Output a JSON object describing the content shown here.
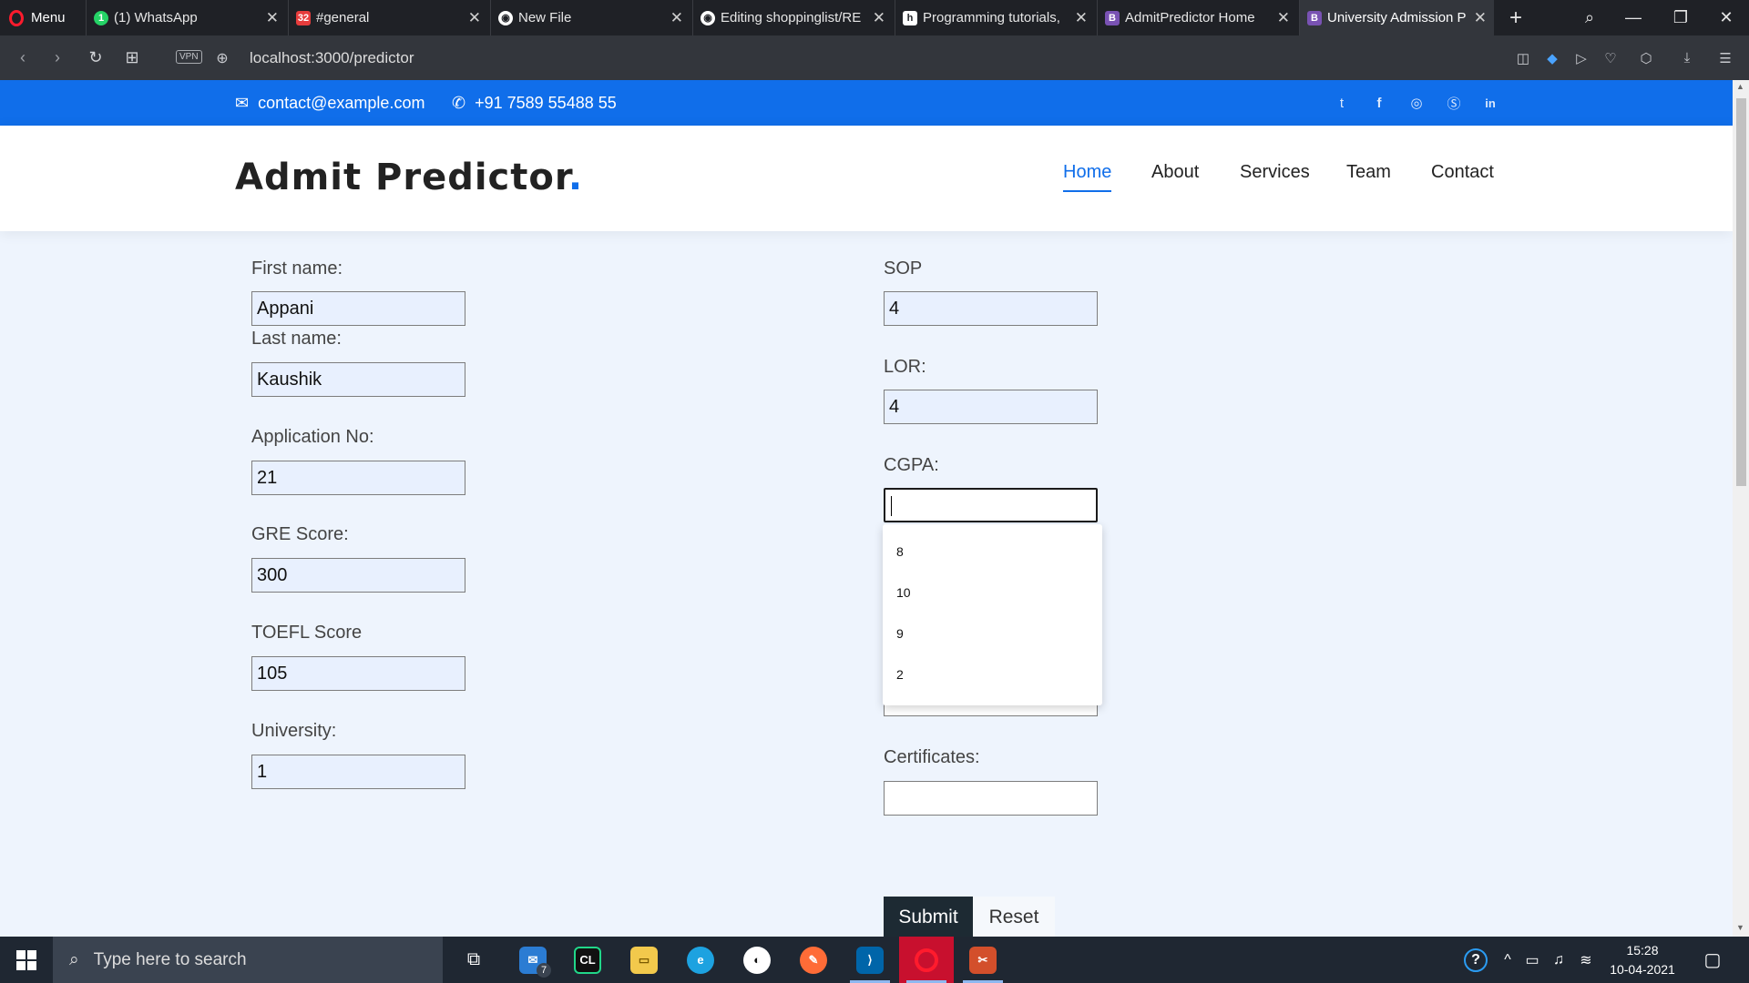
{
  "browser": {
    "menu_label": "Menu",
    "tabs": [
      {
        "label": "(1) WhatsApp",
        "icon": "whatsapp-icon",
        "color": "#25d366"
      },
      {
        "label": "#general",
        "icon": "calendar-icon",
        "color": "#e63c3c"
      },
      {
        "label": "New File",
        "icon": "github-icon",
        "color": "#ffffff"
      },
      {
        "label": "Editing shoppinglist/RE",
        "icon": "github-icon",
        "color": "#ffffff"
      },
      {
        "label": "Programming tutorials,",
        "icon": "hashnode-icon",
        "color": "#ffffff"
      },
      {
        "label": "AdmitPredictor Home",
        "icon": "bootstrap-icon",
        "color": "#7952b3"
      },
      {
        "label": "University Admission P",
        "icon": "bootstrap-icon",
        "color": "#7952b3"
      }
    ],
    "vpn_label": "VPN",
    "url": "localhost:3000/predictor"
  },
  "topbar": {
    "email": "contact@example.com",
    "phone": "+91 7589 55488 55",
    "social": [
      "twitter-icon",
      "facebook-icon",
      "instagram-icon",
      "skype-icon",
      "linkedin-icon"
    ]
  },
  "header": {
    "logo": "Admit Predictor",
    "logo_dot": ".",
    "nav": [
      "Home",
      "About",
      "Services",
      "Team",
      "Contact"
    ],
    "active_nav": "Home"
  },
  "form": {
    "left": [
      {
        "label": "First name:",
        "value": "Appani"
      },
      {
        "label": "Last name:",
        "value": "Kaushik"
      },
      {
        "label": "Application No:",
        "value": "21"
      },
      {
        "label": "GRE Score:",
        "value": "300"
      },
      {
        "label": "TOEFL Score",
        "value": "105"
      },
      {
        "label": "University:",
        "value": "1"
      }
    ],
    "right": [
      {
        "label": "SOP",
        "value": "4"
      },
      {
        "label": "LOR:",
        "value": "4"
      },
      {
        "label": "CGPA:",
        "value": ""
      },
      {
        "label": "Certificates:",
        "value": ""
      }
    ],
    "cgpa_suggestions": [
      "8",
      "10",
      "9",
      "2"
    ],
    "submit_label": "Submit",
    "reset_label": "Reset"
  },
  "taskbar": {
    "search_placeholder": "Type here to search",
    "time": "15:28",
    "date": "10-04-2021",
    "mail_badge": "7"
  },
  "colors": {
    "accent": "#106eea",
    "topbar_bg": "#106eea",
    "button_dark": "#1d2a33"
  }
}
